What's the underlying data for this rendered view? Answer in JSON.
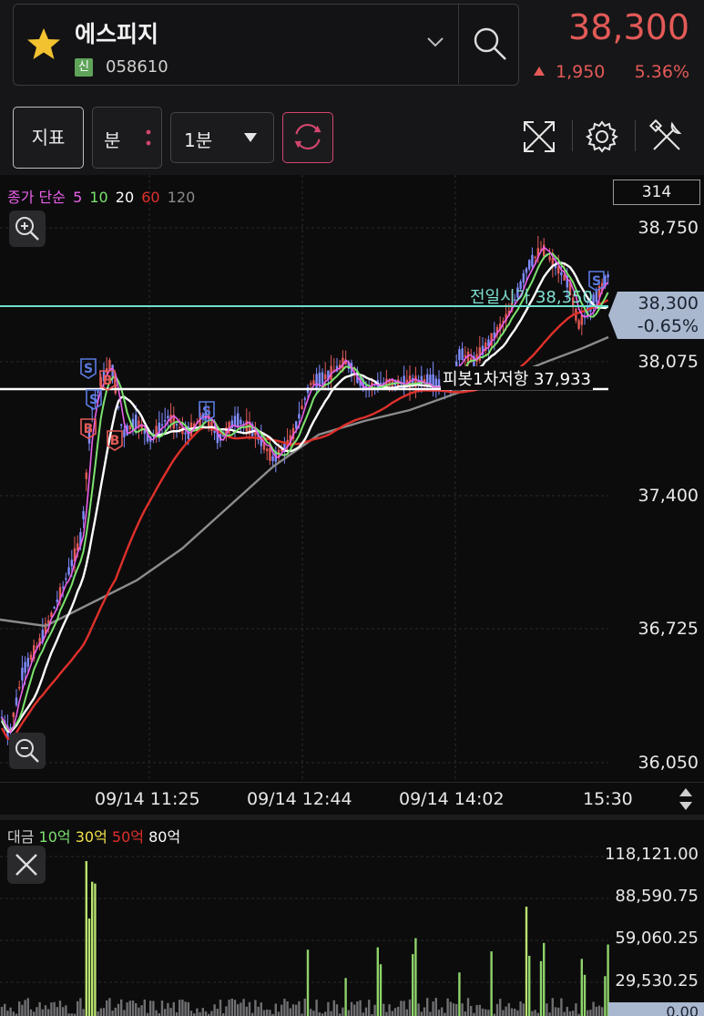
{
  "header": {
    "stock_name": "에스피지",
    "badge": "신",
    "stock_code": "058610",
    "price": "38,300",
    "change": "1,950",
    "change_pct": "5.36%",
    "color_up": "#e35a57"
  },
  "toolbar": {
    "indicator_label": "지표",
    "unit_label": "분",
    "interval_label": "1분",
    "icons": [
      "expand-icon",
      "gear-icon",
      "tools-icon",
      "refresh-icon"
    ]
  },
  "chart": {
    "legend": {
      "prefix": "종가 단순",
      "ma5": "5",
      "ma10": "10",
      "ma20": "20",
      "ma60": "60",
      "ma120": "120",
      "colors": {
        "ma5": "#e860e8",
        "ma10": "#7de36f",
        "ma20": "#ffffff",
        "ma60": "#e0302a",
        "ma120": "#8c8c8c"
      }
    },
    "count_box": "314",
    "y_ticks": [
      "38,750",
      "38,300",
      "38,075",
      "37,400",
      "36,725",
      "36,050"
    ],
    "current_price_label": "38,300",
    "current_pct_label": "-0.65%",
    "prev_open_label": "전일시가 38,350",
    "pivot_label": "피봇1차저항 37,933",
    "x_ticks": [
      "09/14 11:25",
      "09/14 12:44",
      "09/14 14:02",
      "15:30"
    ],
    "markers": {
      "buy": "B",
      "sell": "S"
    }
  },
  "volume": {
    "legend": {
      "prefix": "대금",
      "v10": "10억",
      "v30": "30억",
      "v50": "50억",
      "v80": "80억",
      "colors": {
        "v10": "#7de36f",
        "v30": "#f2e24a",
        "v50": "#e0302a",
        "v80": "#ffffff"
      }
    },
    "y_ticks": [
      "118,121.00",
      "88,590.75",
      "59,060.25",
      "29,530.25"
    ],
    "bottom_label": "0.00"
  }
}
